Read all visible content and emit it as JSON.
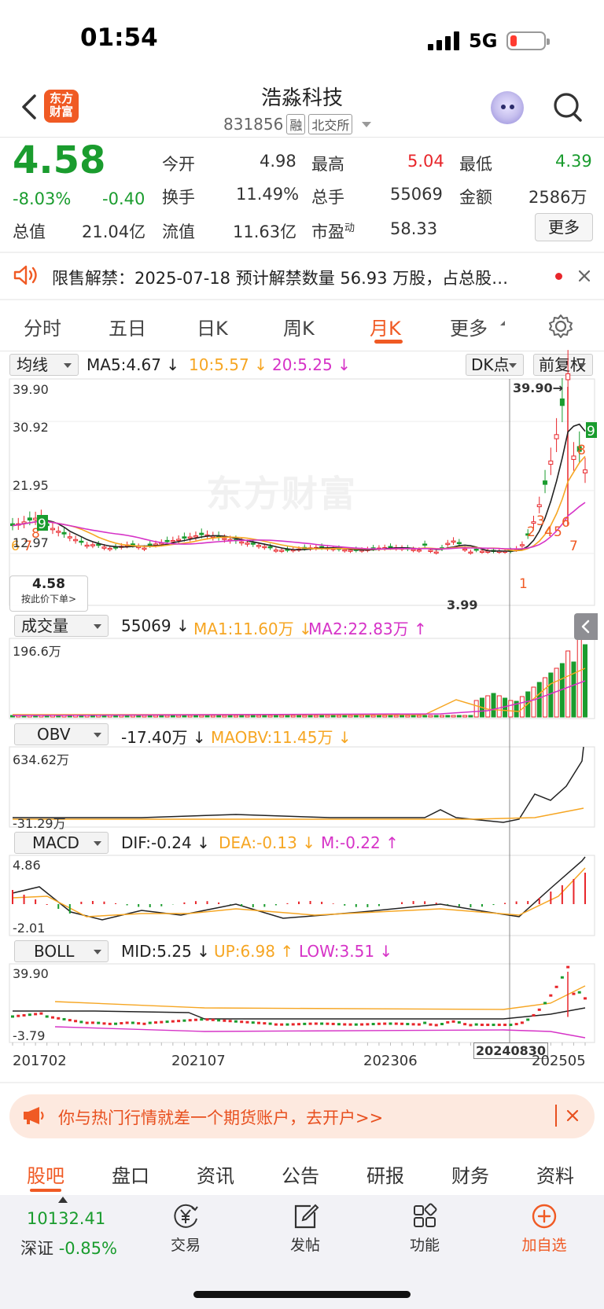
{
  "status_bar": {
    "time": "01:54",
    "network": "5G"
  },
  "header": {
    "logo_text": "东方财富",
    "stock_name": "浩淼科技",
    "code": "831856",
    "tag_margin": "融",
    "tag_exchange": "北交所"
  },
  "quote": {
    "price": "4.58",
    "change_pct": "-8.03%",
    "change_amt": "-0.40",
    "open_label": "今开",
    "open": "4.98",
    "high_label": "最高",
    "high": "5.04",
    "low_label": "最低",
    "low": "4.39",
    "turnover_label": "换手",
    "turnover": "11.49%",
    "volume_label": "总手",
    "volume": "55069",
    "amount_label": "金额",
    "amount": "2586万",
    "mktcap_label": "总值",
    "mktcap": "21.04亿",
    "float_label": "流值",
    "float": "11.63亿",
    "pe_label": "市盈",
    "pe_sup": "动",
    "pe": "58.33",
    "more": "更多"
  },
  "notice": {
    "text": "限售解禁：2025-07-18 预计解禁数量 56.93 万股，占总股…"
  },
  "tabs": [
    "分时",
    "五日",
    "日K",
    "周K",
    "月K",
    "更多"
  ],
  "active_tab": "月K",
  "kline": {
    "ma_select": "均线",
    "ma5": "MA5:4.67",
    "ma10": "10:5.57",
    "ma20": "20:5.25",
    "dk": "DK点",
    "adjust": "前复权",
    "y_labels": [
      "39.90",
      "30.92",
      "21.95",
      "12.97"
    ],
    "max_note": "39.90→",
    "min_note": "3.99",
    "price_tip": "4.58",
    "price_tip_sub": "按此价下单>",
    "watermark": "东方财富",
    "marks": [
      "6",
      "7",
      "8",
      "9",
      "1",
      "2",
      "3",
      "4",
      "5",
      "6",
      "7",
      "8",
      "9"
    ]
  },
  "volume_panel": {
    "select": "成交量",
    "value": "55069",
    "ma1": "MA1:11.60万",
    "ma2": "MA2:22.83万",
    "top": "196.6万"
  },
  "obv_panel": {
    "select": "OBV",
    "value": "-17.40万",
    "ma": "MAOBV:11.45万",
    "top": "634.62万",
    "bottom": "-31.29万"
  },
  "macd_panel": {
    "select": "MACD",
    "dif": "DIF:-0.24",
    "dea": "DEA:-0.13",
    "m": "M:-0.22",
    "top": "4.86",
    "bottom": "-2.01"
  },
  "boll_panel": {
    "select": "BOLL",
    "mid": "MID:5.25",
    "up": "UP:6.98",
    "low": "LOW:3.51",
    "top": "39.90",
    "bottom": "-3.79"
  },
  "x_axis": [
    "201702",
    "202107",
    "202306",
    "20240830",
    "202505"
  ],
  "banner": {
    "text": "你与热门行情就差一个期货账户，去开户>>"
  },
  "bottom_tabs": [
    "股吧",
    "盘口",
    "资讯",
    "公告",
    "研报",
    "财务",
    "资料"
  ],
  "active_bottom_tab": "股吧",
  "nav": {
    "index_value": "10132.41",
    "index_name": "深证",
    "index_change": "-0.85%",
    "items": [
      "交易",
      "发帖",
      "功能",
      "加自选"
    ]
  },
  "colors": {
    "up": "#e8262b",
    "down": "#1a9c2e",
    "accent": "#f05a24",
    "ma10": "#f6a623",
    "ma20": "#d633c7"
  },
  "chart_data": {
    "type": "candlestick",
    "period": "monthly",
    "x_labels": [
      "201702",
      "202107",
      "202306",
      "20240830",
      "202505"
    ],
    "price_range": [
      3.99,
      39.9
    ],
    "last_close": 4.58,
    "highest": 39.9,
    "lowest": 3.99,
    "ma": {
      "MA5": 4.67,
      "MA10": 5.57,
      "MA20": 5.25
    },
    "volume": {
      "last": 55069,
      "MA1": "11.60万",
      "MA2": "22.83万",
      "max": "196.6万"
    },
    "obv": {
      "last": "-17.40万",
      "MAOBV": "11.45万",
      "max": "634.62万",
      "min": "-31.29万"
    },
    "macd": {
      "DIF": -0.24,
      "DEA": -0.13,
      "M": -0.22,
      "max": 4.86,
      "min": -2.01
    },
    "boll": {
      "MID": 5.25,
      "UP": 6.98,
      "LOW": 3.51,
      "max": 39.9,
      "min": -3.79
    }
  }
}
